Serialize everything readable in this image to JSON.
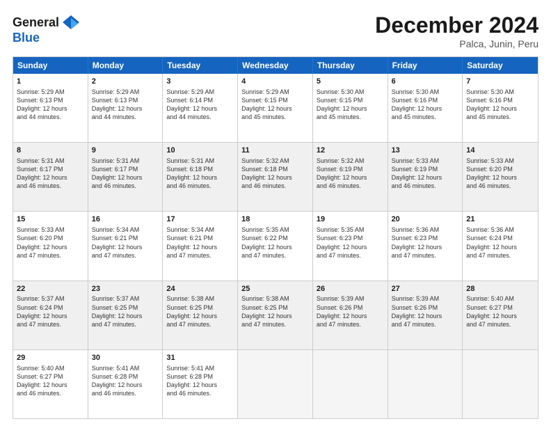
{
  "logo": {
    "line1": "General",
    "line2": "Blue"
  },
  "title": "December 2024",
  "location": "Palca, Junin, Peru",
  "days_of_week": [
    "Sunday",
    "Monday",
    "Tuesday",
    "Wednesday",
    "Thursday",
    "Friday",
    "Saturday"
  ],
  "weeks": [
    [
      {
        "day": "1",
        "info": "Sunrise: 5:29 AM\nSunset: 6:13 PM\nDaylight: 12 hours\nand 44 minutes.",
        "shaded": false
      },
      {
        "day": "2",
        "info": "Sunrise: 5:29 AM\nSunset: 6:13 PM\nDaylight: 12 hours\nand 44 minutes.",
        "shaded": false
      },
      {
        "day": "3",
        "info": "Sunrise: 5:29 AM\nSunset: 6:14 PM\nDaylight: 12 hours\nand 44 minutes.",
        "shaded": false
      },
      {
        "day": "4",
        "info": "Sunrise: 5:29 AM\nSunset: 6:15 PM\nDaylight: 12 hours\nand 45 minutes.",
        "shaded": false
      },
      {
        "day": "5",
        "info": "Sunrise: 5:30 AM\nSunset: 6:15 PM\nDaylight: 12 hours\nand 45 minutes.",
        "shaded": false
      },
      {
        "day": "6",
        "info": "Sunrise: 5:30 AM\nSunset: 6:16 PM\nDaylight: 12 hours\nand 45 minutes.",
        "shaded": false
      },
      {
        "day": "7",
        "info": "Sunrise: 5:30 AM\nSunset: 6:16 PM\nDaylight: 12 hours\nand 45 minutes.",
        "shaded": false
      }
    ],
    [
      {
        "day": "8",
        "info": "Sunrise: 5:31 AM\nSunset: 6:17 PM\nDaylight: 12 hours\nand 46 minutes.",
        "shaded": true
      },
      {
        "day": "9",
        "info": "Sunrise: 5:31 AM\nSunset: 6:17 PM\nDaylight: 12 hours\nand 46 minutes.",
        "shaded": true
      },
      {
        "day": "10",
        "info": "Sunrise: 5:31 AM\nSunset: 6:18 PM\nDaylight: 12 hours\nand 46 minutes.",
        "shaded": true
      },
      {
        "day": "11",
        "info": "Sunrise: 5:32 AM\nSunset: 6:18 PM\nDaylight: 12 hours\nand 46 minutes.",
        "shaded": true
      },
      {
        "day": "12",
        "info": "Sunrise: 5:32 AM\nSunset: 6:19 PM\nDaylight: 12 hours\nand 46 minutes.",
        "shaded": true
      },
      {
        "day": "13",
        "info": "Sunrise: 5:33 AM\nSunset: 6:19 PM\nDaylight: 12 hours\nand 46 minutes.",
        "shaded": true
      },
      {
        "day": "14",
        "info": "Sunrise: 5:33 AM\nSunset: 6:20 PM\nDaylight: 12 hours\nand 46 minutes.",
        "shaded": true
      }
    ],
    [
      {
        "day": "15",
        "info": "Sunrise: 5:33 AM\nSunset: 6:20 PM\nDaylight: 12 hours\nand 47 minutes.",
        "shaded": false
      },
      {
        "day": "16",
        "info": "Sunrise: 5:34 AM\nSunset: 6:21 PM\nDaylight: 12 hours\nand 47 minutes.",
        "shaded": false
      },
      {
        "day": "17",
        "info": "Sunrise: 5:34 AM\nSunset: 6:21 PM\nDaylight: 12 hours\nand 47 minutes.",
        "shaded": false
      },
      {
        "day": "18",
        "info": "Sunrise: 5:35 AM\nSunset: 6:22 PM\nDaylight: 12 hours\nand 47 minutes.",
        "shaded": false
      },
      {
        "day": "19",
        "info": "Sunrise: 5:35 AM\nSunset: 6:23 PM\nDaylight: 12 hours\nand 47 minutes.",
        "shaded": false
      },
      {
        "day": "20",
        "info": "Sunrise: 5:36 AM\nSunset: 6:23 PM\nDaylight: 12 hours\nand 47 minutes.",
        "shaded": false
      },
      {
        "day": "21",
        "info": "Sunrise: 5:36 AM\nSunset: 6:24 PM\nDaylight: 12 hours\nand 47 minutes.",
        "shaded": false
      }
    ],
    [
      {
        "day": "22",
        "info": "Sunrise: 5:37 AM\nSunset: 6:24 PM\nDaylight: 12 hours\nand 47 minutes.",
        "shaded": true
      },
      {
        "day": "23",
        "info": "Sunrise: 5:37 AM\nSunset: 6:25 PM\nDaylight: 12 hours\nand 47 minutes.",
        "shaded": true
      },
      {
        "day": "24",
        "info": "Sunrise: 5:38 AM\nSunset: 6:25 PM\nDaylight: 12 hours\nand 47 minutes.",
        "shaded": true
      },
      {
        "day": "25",
        "info": "Sunrise: 5:38 AM\nSunset: 6:25 PM\nDaylight: 12 hours\nand 47 minutes.",
        "shaded": true
      },
      {
        "day": "26",
        "info": "Sunrise: 5:39 AM\nSunset: 6:26 PM\nDaylight: 12 hours\nand 47 minutes.",
        "shaded": true
      },
      {
        "day": "27",
        "info": "Sunrise: 5:39 AM\nSunset: 6:26 PM\nDaylight: 12 hours\nand 47 minutes.",
        "shaded": true
      },
      {
        "day": "28",
        "info": "Sunrise: 5:40 AM\nSunset: 6:27 PM\nDaylight: 12 hours\nand 47 minutes.",
        "shaded": true
      }
    ],
    [
      {
        "day": "29",
        "info": "Sunrise: 5:40 AM\nSunset: 6:27 PM\nDaylight: 12 hours\nand 46 minutes.",
        "shaded": false
      },
      {
        "day": "30",
        "info": "Sunrise: 5:41 AM\nSunset: 6:28 PM\nDaylight: 12 hours\nand 46 minutes.",
        "shaded": false
      },
      {
        "day": "31",
        "info": "Sunrise: 5:41 AM\nSunset: 6:28 PM\nDaylight: 12 hours\nand 46 minutes.",
        "shaded": false
      },
      {
        "day": "",
        "info": "",
        "shaded": false,
        "empty": true
      },
      {
        "day": "",
        "info": "",
        "shaded": false,
        "empty": true
      },
      {
        "day": "",
        "info": "",
        "shaded": false,
        "empty": true
      },
      {
        "day": "",
        "info": "",
        "shaded": false,
        "empty": true
      }
    ]
  ]
}
